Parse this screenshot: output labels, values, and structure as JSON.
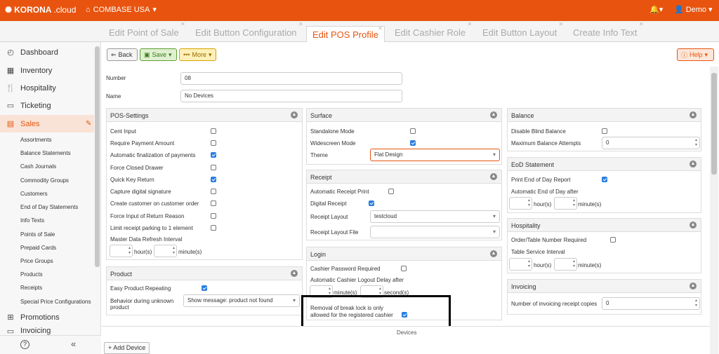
{
  "topbar": {
    "logo_bold": "KORONA",
    "logo_light": ".cloud",
    "company": "COMBASE USA",
    "user": "Demo"
  },
  "tabs": [
    {
      "label": "Edit Point of Sale"
    },
    {
      "label": "Edit Button Configuration"
    },
    {
      "label": "Edit POS Profile",
      "active": true
    },
    {
      "label": "Edit Cashier Role"
    },
    {
      "label": "Edit Button Layout"
    },
    {
      "label": "Create Info Text"
    }
  ],
  "sidebar": {
    "items": [
      {
        "label": "Dashboard",
        "icon": "dashboard-icon"
      },
      {
        "label": "Inventory",
        "icon": "inventory-icon"
      },
      {
        "label": "Hospitality",
        "icon": "hospitality-icon"
      },
      {
        "label": "Ticketing",
        "icon": "ticket-icon"
      },
      {
        "label": "Sales",
        "icon": "sales-icon",
        "active": true
      }
    ],
    "subitems": [
      "Assortments",
      "Balance Statements",
      "Cash Journals",
      "Commodity Groups",
      "Customers",
      "End of Day Statements",
      "Info Texts",
      "Points of Sale",
      "Prepaid Cards",
      "Price Groups",
      "Products",
      "Receipts",
      "Special Price Configurations"
    ],
    "after": [
      {
        "label": "Promotions",
        "icon": "promotions-icon"
      },
      {
        "label": "Invoicing",
        "icon": "invoicing-icon"
      }
    ]
  },
  "toolbar": {
    "back": "Back",
    "save": "Save",
    "more": "More",
    "help": "Help"
  },
  "form": {
    "number_label": "Number",
    "number_value": "08",
    "name_label": "Name",
    "name_value": "No Devices"
  },
  "pos_settings": {
    "title": "POS-Settings",
    "rows": [
      {
        "label": "Cent Input",
        "checked": false
      },
      {
        "label": "Require Payment Amount",
        "checked": false
      },
      {
        "label": "Automatic finalization of payments",
        "checked": true
      },
      {
        "label": "Force Closed Drawer",
        "checked": false
      },
      {
        "label": "Quick Key Return",
        "checked": true
      },
      {
        "label": "Capture digital signature",
        "checked": false
      },
      {
        "label": "Create customer on customer order",
        "checked": false
      },
      {
        "label": "Force Input of Return Reason",
        "checked": false
      },
      {
        "label": "Limit receipt parking to 1 element",
        "checked": false
      }
    ],
    "refresh_label": "Master Data Refresh Interval",
    "hours": "hour(s)",
    "minutes": "minute(s)"
  },
  "product": {
    "title": "Product",
    "easy_repeat": "Easy Product Repeating",
    "behavior_label_1": "Behavior during unknown",
    "behavior_label_2": "product",
    "behavior_value": "Show message: product not found"
  },
  "surface": {
    "title": "Surface",
    "standalone": "Standalone Mode",
    "widescreen": "Widescreen Mode",
    "theme_label": "Theme",
    "theme_value": "Flat Design"
  },
  "receipt": {
    "title": "Receipt",
    "auto_print": "Automatic Receipt Print",
    "digital": "Digital Receipt",
    "layout_label": "Receipt Layout",
    "layout_value": "testcloud",
    "layout_file_label": "Receipt Layout File",
    "layout_file_value": ""
  },
  "login": {
    "title": "Login",
    "pw_required": "Cashier Password Required",
    "logout_label": "Automatic Cashier Logout Delay after",
    "minutes": "minute(s)",
    "seconds": "second(s)",
    "break_lock_1": "Removal of break lock is only",
    "break_lock_2": "allowed for the registered cashier"
  },
  "balance": {
    "title": "Balance",
    "blind": "Disable Blind Balance",
    "max_label": "Maximum Balance Attempts",
    "max_value": "0"
  },
  "eod": {
    "title": "EoD Statement",
    "print": "Print End of Day Report",
    "auto_label": "Automatic End of Day after",
    "hours": "hour(s)",
    "minutes": "minute(s)"
  },
  "hospitality": {
    "title": "Hospitality",
    "order_table": "Order/Table Number Required",
    "interval_label": "Table Service Interval",
    "hours": "hour(s)",
    "minutes": "minute(s)"
  },
  "invoicing": {
    "title": "Invoicing",
    "copies_label": "Number of invoicing receipt copies",
    "copies_value": "0"
  },
  "devices": {
    "label": "Devices",
    "add": "+ Add Device"
  }
}
